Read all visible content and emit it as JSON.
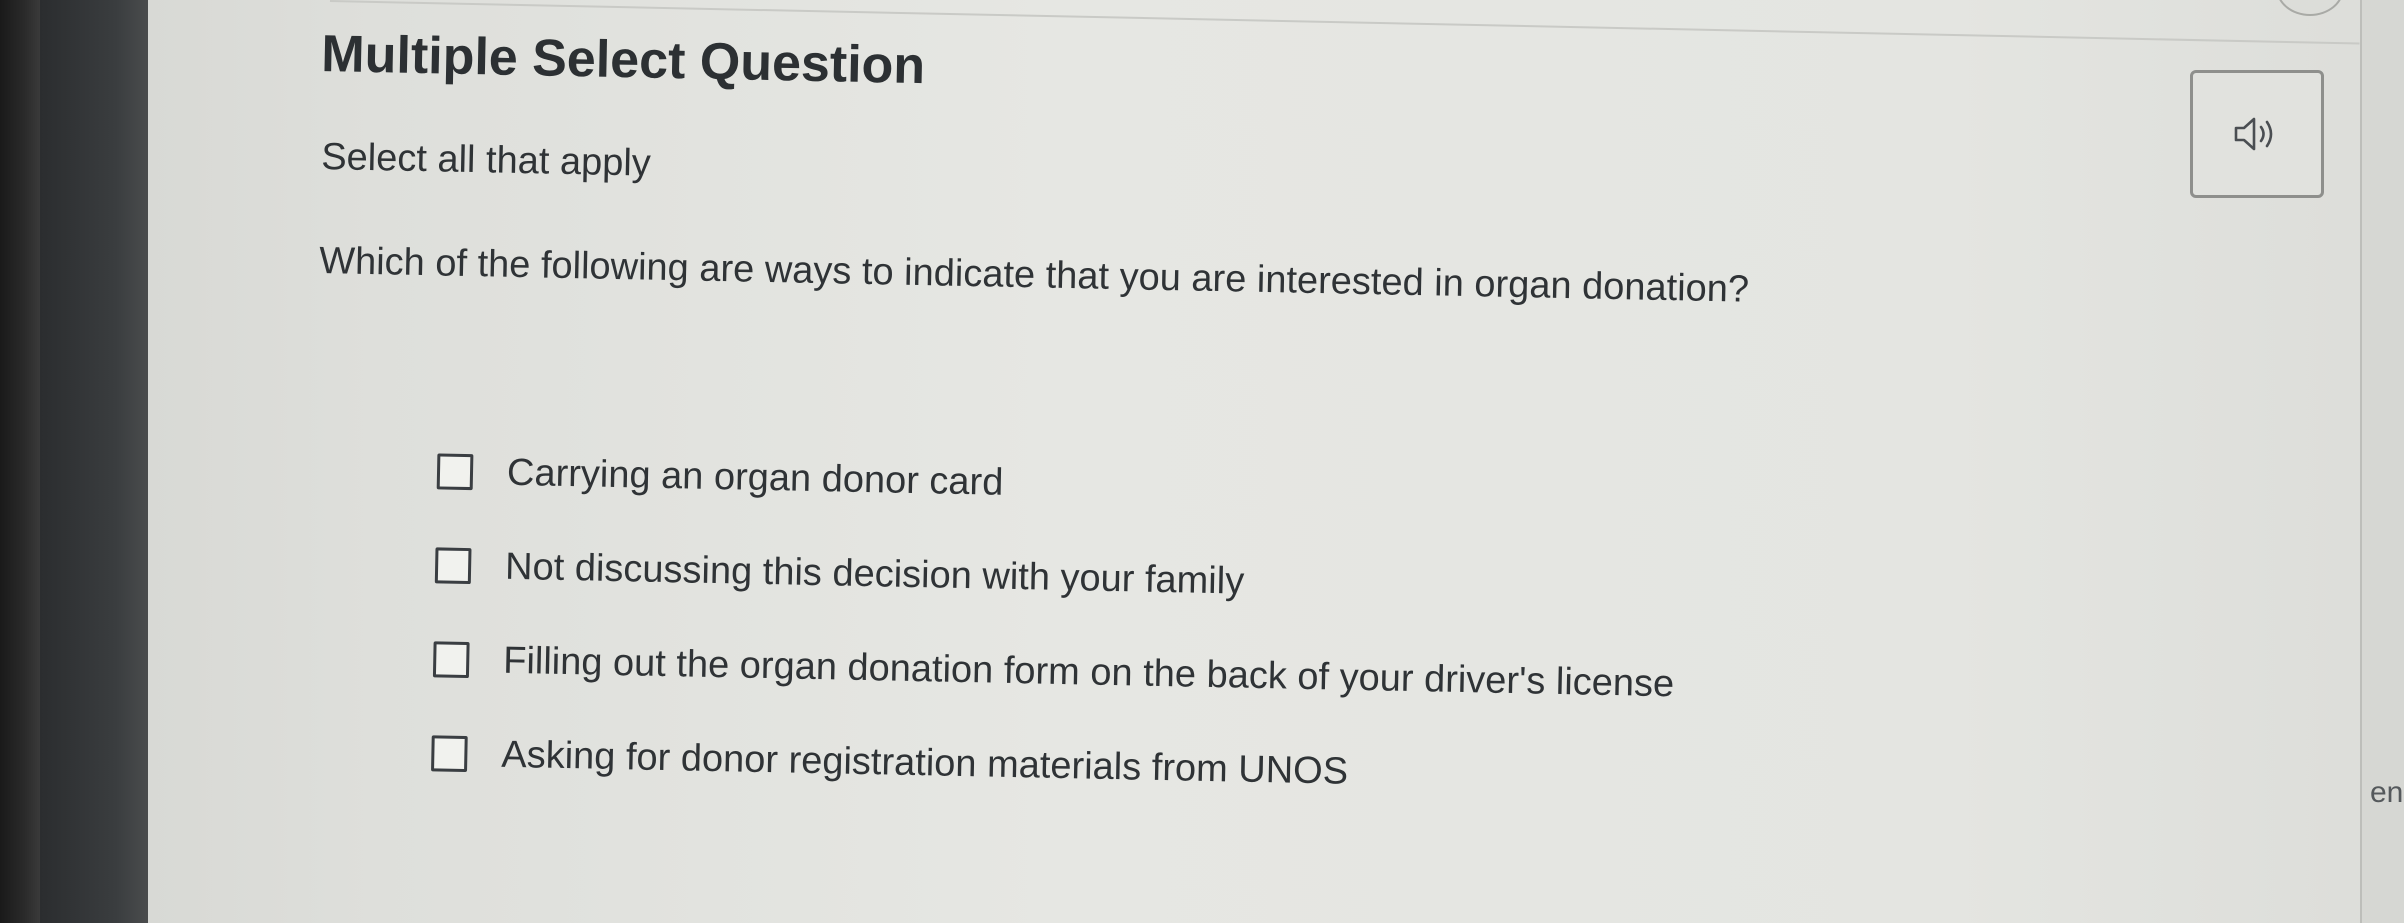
{
  "question": {
    "type_label": "Multiple Select Question",
    "instruction": "Select all that apply",
    "prompt": "Which of the following are ways to indicate that you are interested in organ donation?",
    "options": [
      {
        "label": "Carrying an organ donor card",
        "checked": false
      },
      {
        "label": "Not discussing this decision with your family",
        "checked": false
      },
      {
        "label": "Filling out the organ donation form on the back of your driver's license",
        "checked": false
      },
      {
        "label": "Asking for donor registration materials from UNOS",
        "checked": false
      }
    ]
  },
  "toolbar": {
    "audio_icon": "speaker-icon"
  },
  "side_panel": {
    "fragment_text": "en"
  },
  "colors": {
    "text": "#2f3336",
    "page_background": "#e4e5e1",
    "bezel": "#2a2a2a"
  }
}
